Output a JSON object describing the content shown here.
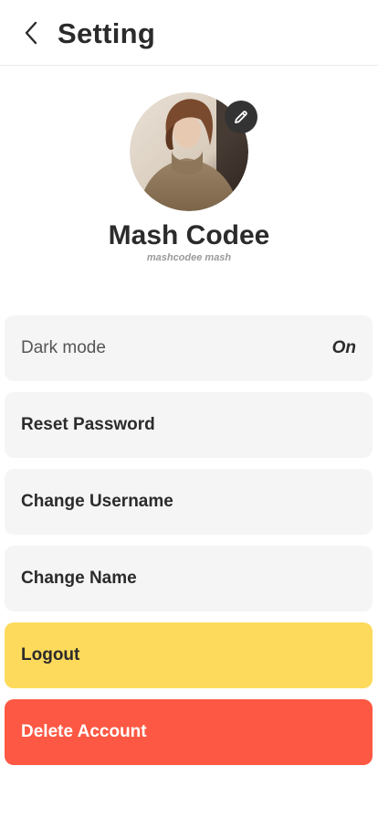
{
  "header": {
    "title": "Setting",
    "back_icon": "chevron-left-icon"
  },
  "profile": {
    "name": "Mash Codee",
    "username": "mashcodee mash",
    "edit_icon": "pencil-icon"
  },
  "settings": {
    "dark_mode": {
      "label": "Dark mode",
      "value": "On"
    },
    "reset_password": {
      "label": "Reset Password"
    },
    "change_username": {
      "label": "Change Username"
    },
    "change_name": {
      "label": "Change Name"
    },
    "logout": {
      "label": "Logout"
    },
    "delete_account": {
      "label": "Delete Account"
    }
  },
  "colors": {
    "item_bg": "#f5f5f5",
    "logout_bg": "#fdda5b",
    "delete_bg": "#fd5843",
    "text": "#2b2b2b",
    "edit_button": "#333333"
  }
}
